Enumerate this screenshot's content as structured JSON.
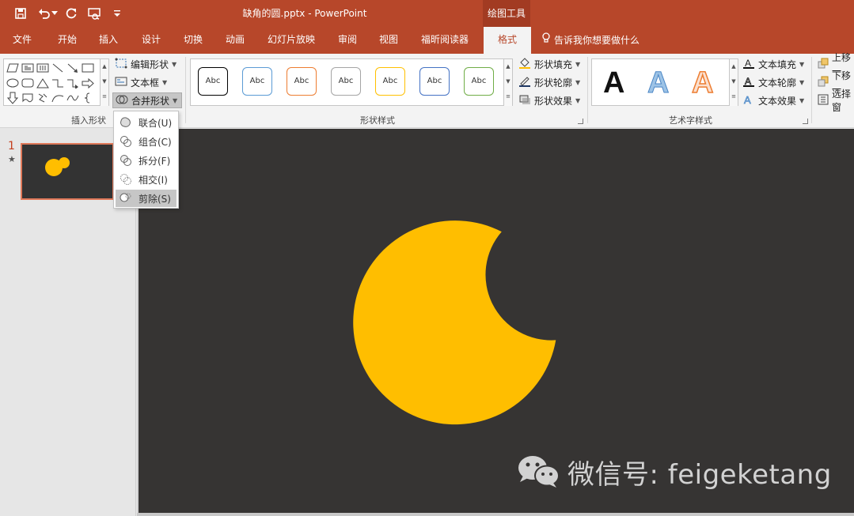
{
  "title_bar": {
    "document_title": "缺角的圆.pptx - PowerPoint",
    "context_tab_label": "绘图工具",
    "qat_icons": [
      "save-icon",
      "undo-icon",
      "redo-icon",
      "presentation-icon",
      "customize-qat-icon"
    ]
  },
  "tabs": [
    {
      "label": "文件"
    },
    {
      "label": "开始"
    },
    {
      "label": "插入"
    },
    {
      "label": "设计"
    },
    {
      "label": "切换"
    },
    {
      "label": "动画"
    },
    {
      "label": "幻灯片放映"
    },
    {
      "label": "审阅"
    },
    {
      "label": "视图"
    },
    {
      "label": "福昕阅读器"
    },
    {
      "label": "格式",
      "active": true
    }
  ],
  "tell_me": "告诉我你想要做什么",
  "ribbon": {
    "insert_shapes": {
      "group_label": "插入形状",
      "edit_shape": "编辑形状",
      "text_box": "文本框",
      "merge_shapes": "合并形状"
    },
    "shape_styles": {
      "group_label": "形状样式",
      "style_thumbnails": [
        "Abc",
        "Abc",
        "Abc",
        "Abc",
        "Abc",
        "Abc",
        "Abc"
      ],
      "style_border_colors": [
        "#000000",
        "#5b9bd5",
        "#ed7d31",
        "#a5a5a5",
        "#ffc000",
        "#4472c4",
        "#70ad47"
      ],
      "shape_fill": "形状填充",
      "shape_outline": "形状轮廓",
      "shape_effects": "形状效果"
    },
    "wordart_styles": {
      "group_label": "艺术字样式",
      "samples": [
        "A",
        "A",
        "A"
      ],
      "text_fill": "文本填充",
      "text_outline": "文本轮廓",
      "text_effects": "文本效果"
    },
    "arrange": {
      "bring_forward": "上移一",
      "send_backward": "下移一",
      "selection_pane": "选择窗"
    }
  },
  "merge_menu": [
    {
      "label": "联合(U)"
    },
    {
      "label": "组合(C)"
    },
    {
      "label": "拆分(F)"
    },
    {
      "label": "相交(I)"
    },
    {
      "label": "剪除(S)",
      "hovered": true
    }
  ],
  "slide_panel": {
    "slide_number": "1",
    "star": "★"
  },
  "slide": {
    "background_color": "#363433",
    "shape_color": "#ffbe00",
    "watermark": "微信号: feigeketang"
  },
  "colors": {
    "brand": "#b7472a",
    "accent_orange": "#c43e1c"
  }
}
